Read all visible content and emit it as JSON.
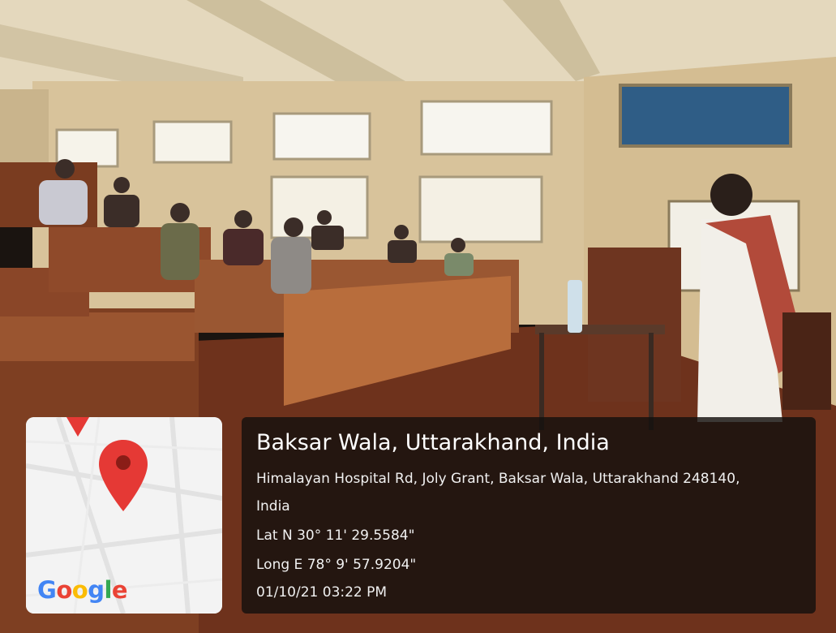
{
  "geotag": {
    "place": "Baksar Wala, Uttarakhand, India",
    "address_line1": "Himalayan Hospital Rd, Joly Grant, Baksar Wala, Uttarakhand 248140,",
    "address_line2": "India",
    "latitude": "Lat N 30° 11' 29.5584\"",
    "longitude": "Long E 78° 9' 57.9204\"",
    "datetime": "01/10/21 03:22 PM"
  },
  "map_card": {
    "brand": [
      "G",
      "o",
      "o",
      "g",
      "l",
      "e"
    ],
    "brand_colors": [
      "#4285F4",
      "#EA4335",
      "#FBBC05",
      "#4285F4",
      "#34A853",
      "#EA4335"
    ],
    "pin_color": "#E53935",
    "pin_icon": "location-pin-icon"
  },
  "scene": {
    "colors": {
      "wall": "#d9c7a3",
      "ceiling": "#e8dcc0",
      "wood": "#8a4a2a",
      "floor": "#7a3a22"
    }
  }
}
